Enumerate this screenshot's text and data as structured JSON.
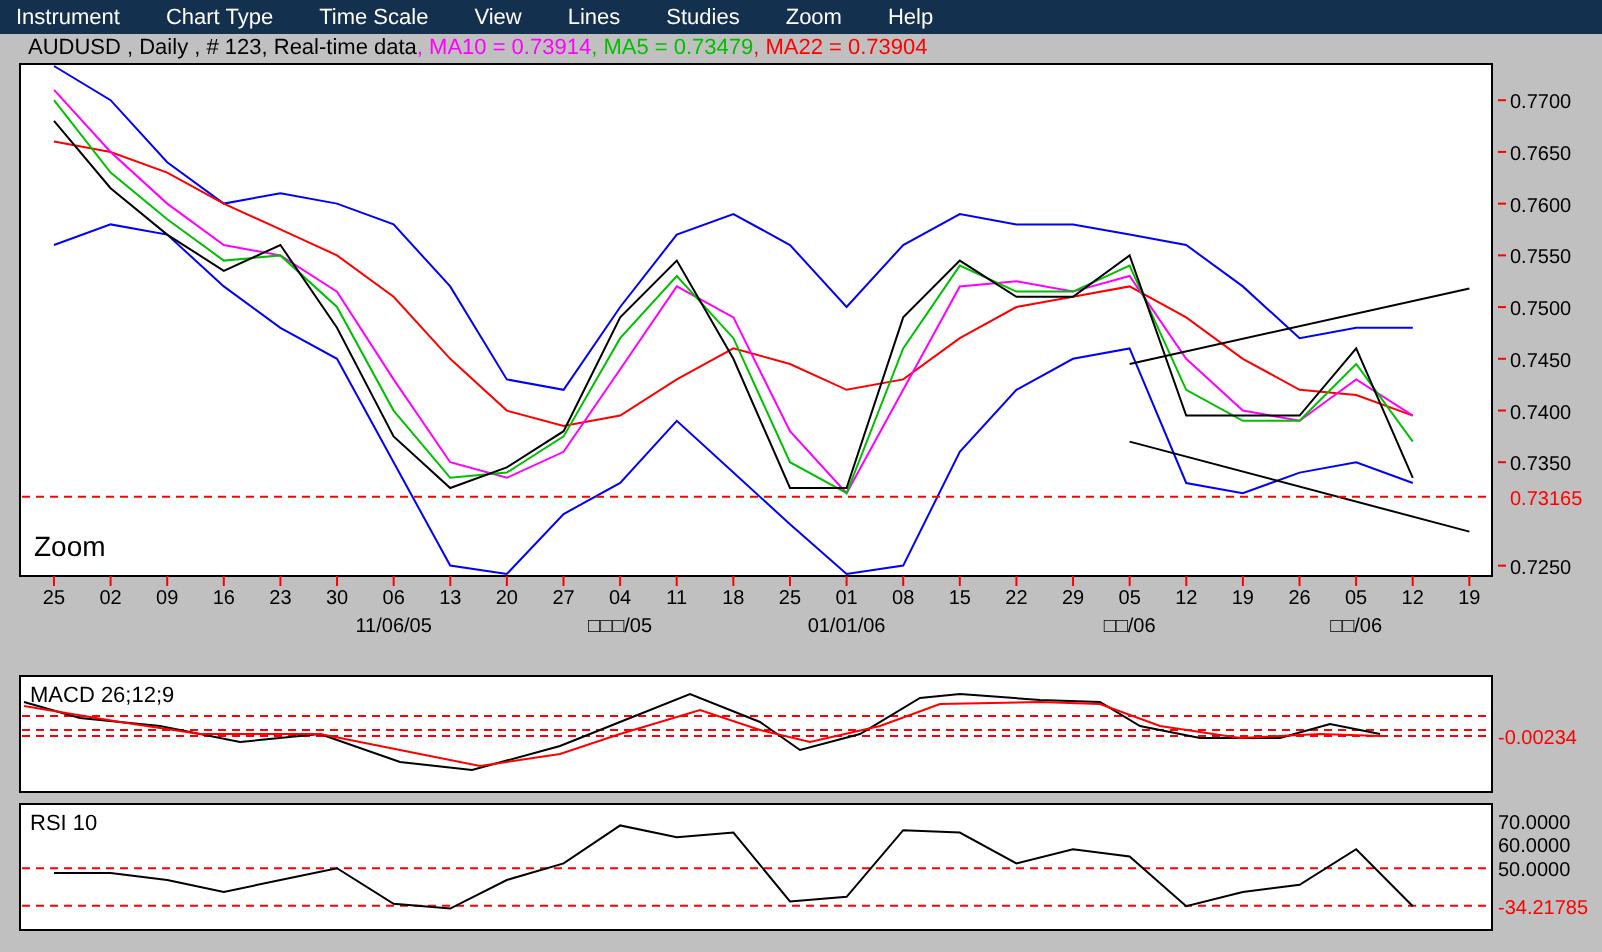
{
  "menu": [
    "Instrument",
    "Chart Type",
    "Time Scale",
    "View",
    "Lines",
    "Studies",
    "Zoom",
    "Help"
  ],
  "info": {
    "text": "AUDUSD , Daily , # 123, Real-time data",
    "indicators": [
      {
        "text": ", MA10 = 0.73914",
        "color": "#ff00ff"
      },
      {
        "text": ", MA5 = 0.73479",
        "color": "#00c000"
      },
      {
        "text": ", MA22 = 0.73904",
        "color": "#ff0000"
      }
    ]
  },
  "price_chart": {
    "zoom_label": "Zoom",
    "chart_data": {
      "type": "line",
      "categories": [
        "25",
        "02",
        "09",
        "16",
        "23",
        "30",
        "06",
        "13",
        "20",
        "27",
        "04",
        "11",
        "18",
        "25",
        "01",
        "08",
        "15",
        "22",
        "29",
        "05",
        "12",
        "19",
        "26",
        "05",
        "12",
        "19"
      ],
      "ylim": [
        0.724,
        0.7735
      ],
      "yticks": [
        {
          "value": 0.77,
          "label": "0.7700"
        },
        {
          "value": 0.765,
          "label": "0.7650"
        },
        {
          "value": 0.76,
          "label": "0.7600"
        },
        {
          "value": 0.755,
          "label": "0.7550"
        },
        {
          "value": 0.75,
          "label": "0.7500"
        },
        {
          "value": 0.745,
          "label": "0.7450"
        },
        {
          "value": 0.74,
          "label": "0.7400"
        },
        {
          "value": 0.735,
          "label": "0.7350"
        },
        {
          "value": 0.725,
          "label": "0.7250"
        }
      ],
      "series": [
        {
          "color": "#0000ff",
          "values": [
            0.7733,
            0.77,
            0.764,
            0.76,
            0.761,
            0.76,
            0.758,
            0.752,
            0.743,
            0.742,
            0.75,
            0.757,
            0.759,
            0.756,
            0.75,
            0.756,
            0.759,
            0.758,
            0.758,
            0.757,
            0.756,
            0.752,
            0.747,
            0.748,
            0.748,
            null
          ]
        },
        {
          "color": "#0000ff",
          "values": [
            0.756,
            0.758,
            0.757,
            0.752,
            0.748,
            0.745,
            0.735,
            0.725,
            0.7242,
            0.73,
            0.733,
            0.739,
            0.734,
            0.729,
            0.7242,
            0.725,
            0.736,
            0.742,
            0.745,
            0.746,
            0.733,
            0.732,
            0.734,
            0.735,
            0.733,
            null
          ]
        },
        {
          "color": "#ff0000",
          "values": [
            0.766,
            0.765,
            0.763,
            0.76,
            0.7575,
            0.755,
            0.751,
            0.745,
            0.74,
            0.7385,
            0.7395,
            0.743,
            0.746,
            0.7445,
            0.742,
            0.743,
            0.747,
            0.75,
            0.751,
            0.752,
            0.749,
            0.745,
            0.742,
            0.7415,
            0.7395,
            null
          ]
        },
        {
          "color": "#ff00ff",
          "values": [
            0.771,
            0.765,
            0.76,
            0.756,
            0.755,
            0.7515,
            0.743,
            0.735,
            0.7335,
            0.736,
            0.744,
            0.752,
            0.749,
            0.738,
            0.732,
            0.742,
            0.752,
            0.7525,
            0.7515,
            0.753,
            0.745,
            0.74,
            0.739,
            0.743,
            0.7395,
            null
          ]
        },
        {
          "color": "#00c000",
          "values": [
            0.77,
            0.763,
            0.7585,
            0.7545,
            0.755,
            0.75,
            0.74,
            0.7335,
            0.734,
            0.7375,
            0.747,
            0.753,
            0.747,
            0.735,
            0.732,
            0.746,
            0.754,
            0.7515,
            0.7515,
            0.754,
            0.742,
            0.739,
            0.739,
            0.7445,
            0.737,
            null
          ]
        },
        {
          "color": "#000000",
          "values": [
            0.768,
            0.7615,
            0.757,
            0.7535,
            0.756,
            0.748,
            0.7375,
            0.7325,
            0.7345,
            0.738,
            0.749,
            0.7545,
            0.745,
            0.7325,
            0.7325,
            0.749,
            0.7545,
            0.751,
            0.751,
            0.755,
            0.7395,
            0.7395,
            0.7395,
            0.746,
            0.7335,
            null
          ]
        },
        {
          "color": "#000000",
          "values": [
            null,
            null,
            null,
            null,
            null,
            null,
            null,
            null,
            null,
            null,
            null,
            null,
            null,
            null,
            null,
            null,
            null,
            null,
            null,
            0.7445,
            null,
            null,
            null,
            null,
            null,
            0.7518
          ]
        },
        {
          "color": "#000000",
          "values": [
            null,
            null,
            null,
            null,
            null,
            null,
            null,
            null,
            null,
            null,
            null,
            null,
            null,
            null,
            null,
            null,
            null,
            null,
            null,
            0.737,
            null,
            null,
            null,
            null,
            null,
            0.7283
          ]
        }
      ],
      "ref_lines": [
        {
          "axis": "y",
          "value": 0.73165,
          "label": "0.73165"
        }
      ]
    },
    "month_labels": [
      "11/06/05",
      "□□□/05",
      "01/01/06",
      "□□/06",
      "□□/06"
    ]
  },
  "macd": {
    "title": "MACD 26;12;9",
    "reading": "-0.00234"
  },
  "rsi": {
    "title": "RSI 10",
    "reading": "-34.21785",
    "chart_data": {
      "type": "line",
      "ylim": [
        24,
        77
      ],
      "yticks": [
        {
          "value": 70,
          "label": "70.0000"
        },
        {
          "value": 60,
          "label": "60.0000"
        },
        {
          "value": 50,
          "label": "50.0000"
        }
      ],
      "series": [
        {
          "color": "#000000",
          "values": [
            48,
            48,
            45,
            40,
            45,
            50,
            35,
            33,
            45,
            52,
            68,
            63,
            65,
            36,
            38,
            66,
            65,
            52,
            58,
            55,
            34,
            40,
            43,
            58,
            34,
            null
          ]
        }
      ],
      "ref_lines": [
        {
          "axis": "y",
          "value": 50
        },
        {
          "axis": "y",
          "value": 34.21785
        }
      ]
    }
  }
}
